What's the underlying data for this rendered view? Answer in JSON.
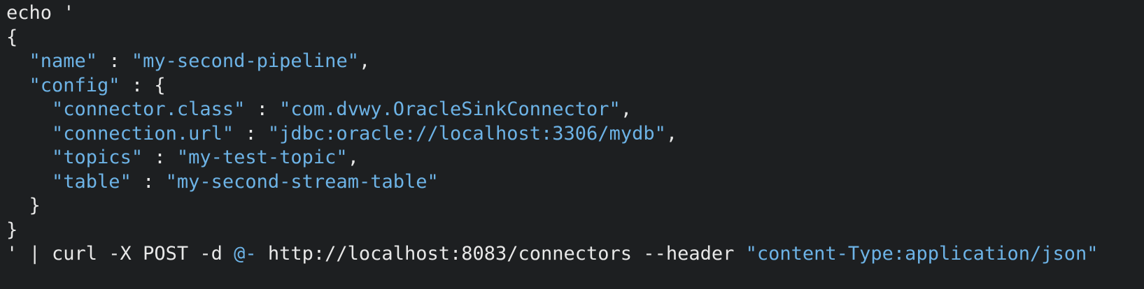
{
  "lines": [
    [
      {
        "t": "echo '",
        "c": "plain"
      }
    ],
    [
      {
        "t": "{",
        "c": "plain"
      }
    ],
    [
      {
        "t": "  ",
        "c": "plain"
      },
      {
        "t": "\"name\"",
        "c": "str"
      },
      {
        "t": " : ",
        "c": "plain"
      },
      {
        "t": "\"my-second-pipeline\"",
        "c": "str"
      },
      {
        "t": ",",
        "c": "plain"
      }
    ],
    [
      {
        "t": "  ",
        "c": "plain"
      },
      {
        "t": "\"config\"",
        "c": "str"
      },
      {
        "t": " : {",
        "c": "plain"
      }
    ],
    [
      {
        "t": "    ",
        "c": "plain"
      },
      {
        "t": "\"connector.class\"",
        "c": "str"
      },
      {
        "t": " : ",
        "c": "plain"
      },
      {
        "t": "\"com.dvwy.OracleSinkConnector\"",
        "c": "str"
      },
      {
        "t": ",",
        "c": "plain"
      }
    ],
    [
      {
        "t": "    ",
        "c": "plain"
      },
      {
        "t": "\"connection.url\"",
        "c": "str"
      },
      {
        "t": " : ",
        "c": "plain"
      },
      {
        "t": "\"jdbc:oracle://localhost:3306/mydb\"",
        "c": "str"
      },
      {
        "t": ",",
        "c": "plain"
      }
    ],
    [
      {
        "t": "    ",
        "c": "plain"
      },
      {
        "t": "\"topics\"",
        "c": "str"
      },
      {
        "t": " : ",
        "c": "plain"
      },
      {
        "t": "\"my-test-topic\"",
        "c": "str"
      },
      {
        "t": ",",
        "c": "plain"
      }
    ],
    [
      {
        "t": "    ",
        "c": "plain"
      },
      {
        "t": "\"table\"",
        "c": "str"
      },
      {
        "t": " : ",
        "c": "plain"
      },
      {
        "t": "\"my-second-stream-table\"",
        "c": "str"
      }
    ],
    [
      {
        "t": "  }",
        "c": "plain"
      }
    ],
    [
      {
        "t": "}",
        "c": "plain"
      }
    ],
    [
      {
        "t": "' | curl -X POST -d ",
        "c": "plain"
      },
      {
        "t": "@-",
        "c": "str"
      },
      {
        "t": " http://localhost:8083/connectors --header ",
        "c": "plain"
      },
      {
        "t": "\"content-Type:application/json\"",
        "c": "str"
      }
    ]
  ],
  "colors": {
    "background": "#1d1f21",
    "text": "#e8e8e8",
    "string": "#6db3e6"
  }
}
